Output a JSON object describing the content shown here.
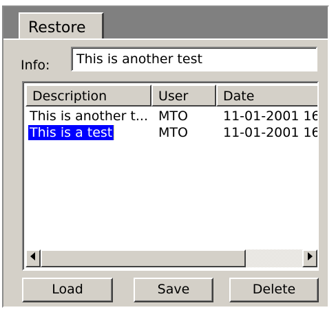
{
  "tab": {
    "label": "Restore"
  },
  "info": {
    "label": "Info:",
    "value": "This is another test"
  },
  "list": {
    "columns": [
      "Description",
      "User",
      "Date"
    ],
    "rows": [
      {
        "description": "This is another t...",
        "user": "MTO",
        "date": "11-01-2001 16",
        "selected": false
      },
      {
        "description": "This is a test",
        "user": "MTO",
        "date": "11-01-2001 16",
        "selected": true
      }
    ]
  },
  "buttons": {
    "load": "Load",
    "save": "Save",
    "delete": "Delete"
  },
  "scrollbar": {
    "left_icon": "arrow-left-icon",
    "right_icon": "arrow-right-icon"
  },
  "colors": {
    "face": "#d4d0c8",
    "selection": "#0000ff",
    "tabstrip": "#808080"
  }
}
